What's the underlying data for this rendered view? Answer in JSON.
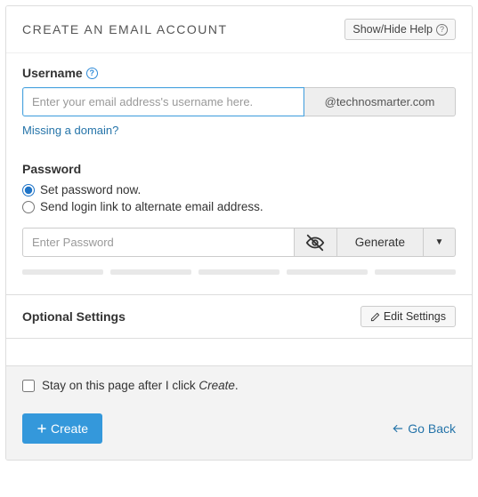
{
  "header": {
    "title": "CREATE AN EMAIL ACCOUNT",
    "help_button": "Show/Hide Help"
  },
  "username": {
    "label": "Username",
    "placeholder": "Enter your email address's username here.",
    "value": "",
    "domain": "@technosmarter.com",
    "missing_link": "Missing a domain?"
  },
  "password": {
    "label": "Password",
    "option_now": "Set password now.",
    "option_link": "Send login link to alternate email address.",
    "selected": "now",
    "placeholder": "Enter Password",
    "value": "",
    "generate": "Generate"
  },
  "optional": {
    "title": "Optional Settings",
    "edit_button": "Edit Settings"
  },
  "footer": {
    "stay_prefix": "Stay on this page after I click ",
    "stay_action": "Create",
    "stay_suffix": ".",
    "stay_checked": false,
    "create_button": "Create",
    "goback": "Go Back"
  }
}
